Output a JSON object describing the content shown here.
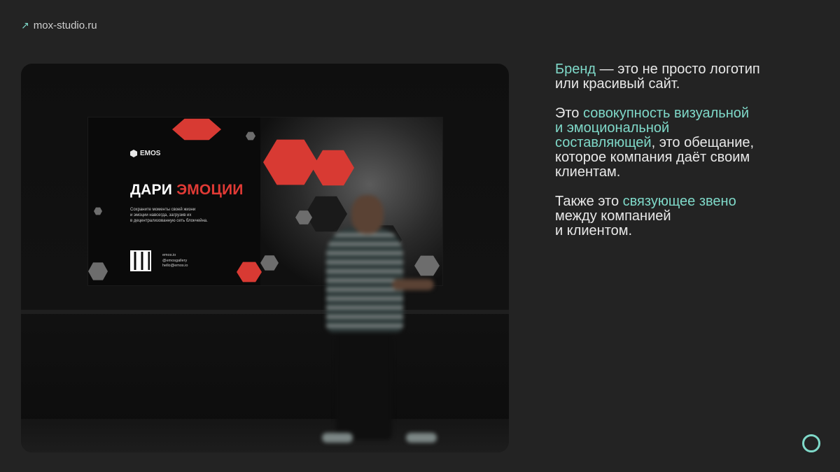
{
  "header": {
    "site_arrow": "↗",
    "site_label": "mox-studio.ru"
  },
  "poster": {
    "logo_text": "EMOS",
    "headline_part1": "ДАРИ",
    "headline_part2": "ЭМОЦИИ",
    "body_line1": "Сохраните моменты своей жизни",
    "body_line2": "и эмоции навсегда, загрузив их",
    "body_line3": "в децентрализованную сеть блокчейна.",
    "contact_site": "emos.io",
    "contact_handle": "@emosgallery",
    "contact_email": "hello@emos.io"
  },
  "copy": {
    "p1_hl": "Бренд",
    "p1_rest_line1": " — это не просто логотип",
    "p1_rest_line2": "или красивый сайт.",
    "p2_start": "Это ",
    "p2_hl_line1": "совокупность визуальной",
    "p2_hl_line2": "и эмоциональной",
    "p2_hl_line3": "составляющей",
    "p2_rest_line1": ", это обещание,",
    "p2_rest_line2": "которое компания даёт своим",
    "p2_rest_line3": "клиентам.",
    "p3_start": "Также это ",
    "p3_hl": "связующее звено",
    "p3_rest_line1": "между компанией",
    "p3_rest_line2": "и клиентом."
  },
  "colors": {
    "accent": "#7fd9c9",
    "poster_red": "#e03a35",
    "background": "#232323"
  }
}
